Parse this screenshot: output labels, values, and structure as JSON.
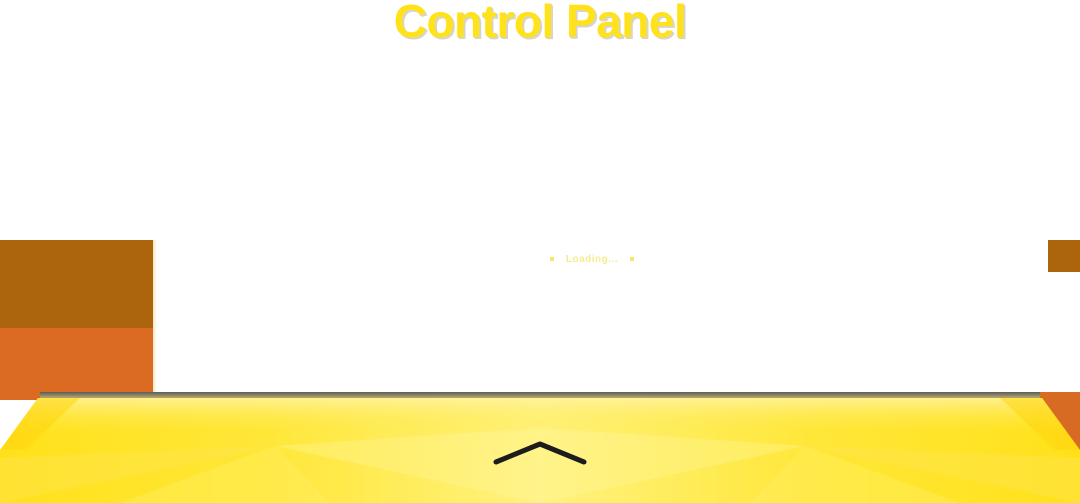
{
  "header": {
    "title": "Control Panel"
  },
  "status": {
    "text": "Loading..."
  },
  "drawer": {
    "toggle_icon": "chevron-up-icon"
  },
  "colors": {
    "title": "#ffe21a",
    "panel_brown": "#ac650d",
    "panel_orange": "#db6a22",
    "drawer_yellow": "#ffe21a",
    "status_text": "#f1e76a"
  }
}
